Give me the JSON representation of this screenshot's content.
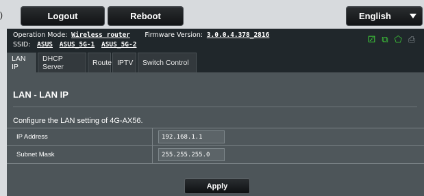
{
  "topbar": {
    "logout_label": "Logout",
    "reboot_label": "Reboot",
    "language_label": "English",
    "edge_glyph": ")"
  },
  "info": {
    "operation_mode_label": "Operation Mode:",
    "operation_mode_value": "Wireless router",
    "firmware_label": "Firmware Version:",
    "firmware_value": "3.0.0.4.378_2816",
    "ssid_label": "SSID:",
    "ssids": [
      "ASUS",
      "ASUS_5G-1",
      "ASUS_5G-2"
    ]
  },
  "status_icons": [
    {
      "name": "clients-icon",
      "glyph": "⚂",
      "color": "#3fd13a"
    },
    {
      "name": "copy-icon",
      "glyph": "⧉",
      "color": "#3fd13a"
    },
    {
      "name": "usb-icon",
      "glyph": "⬠",
      "color": "#3fd13a"
    },
    {
      "name": "printer-icon",
      "glyph": "⎙",
      "color": "#7d8488"
    }
  ],
  "tabs": [
    {
      "label": "LAN IP",
      "active": true
    },
    {
      "label": "DHCP Server",
      "active": false
    },
    {
      "label": "Route",
      "active": false
    },
    {
      "label": "IPTV",
      "active": false
    },
    {
      "label": "Switch Control",
      "active": false
    }
  ],
  "main": {
    "title": "LAN - LAN IP",
    "description": "Configure the LAN setting of 4G-AX56.",
    "fields": [
      {
        "label": "IP Address",
        "value": "192.168.1.1"
      },
      {
        "label": "Subnet Mask",
        "value": "255.255.255.0"
      }
    ],
    "apply_label": "Apply"
  },
  "colors": {
    "accent_green": "#3fd13a",
    "panel_dark": "#20272b",
    "content_bg": "#4d5559"
  }
}
